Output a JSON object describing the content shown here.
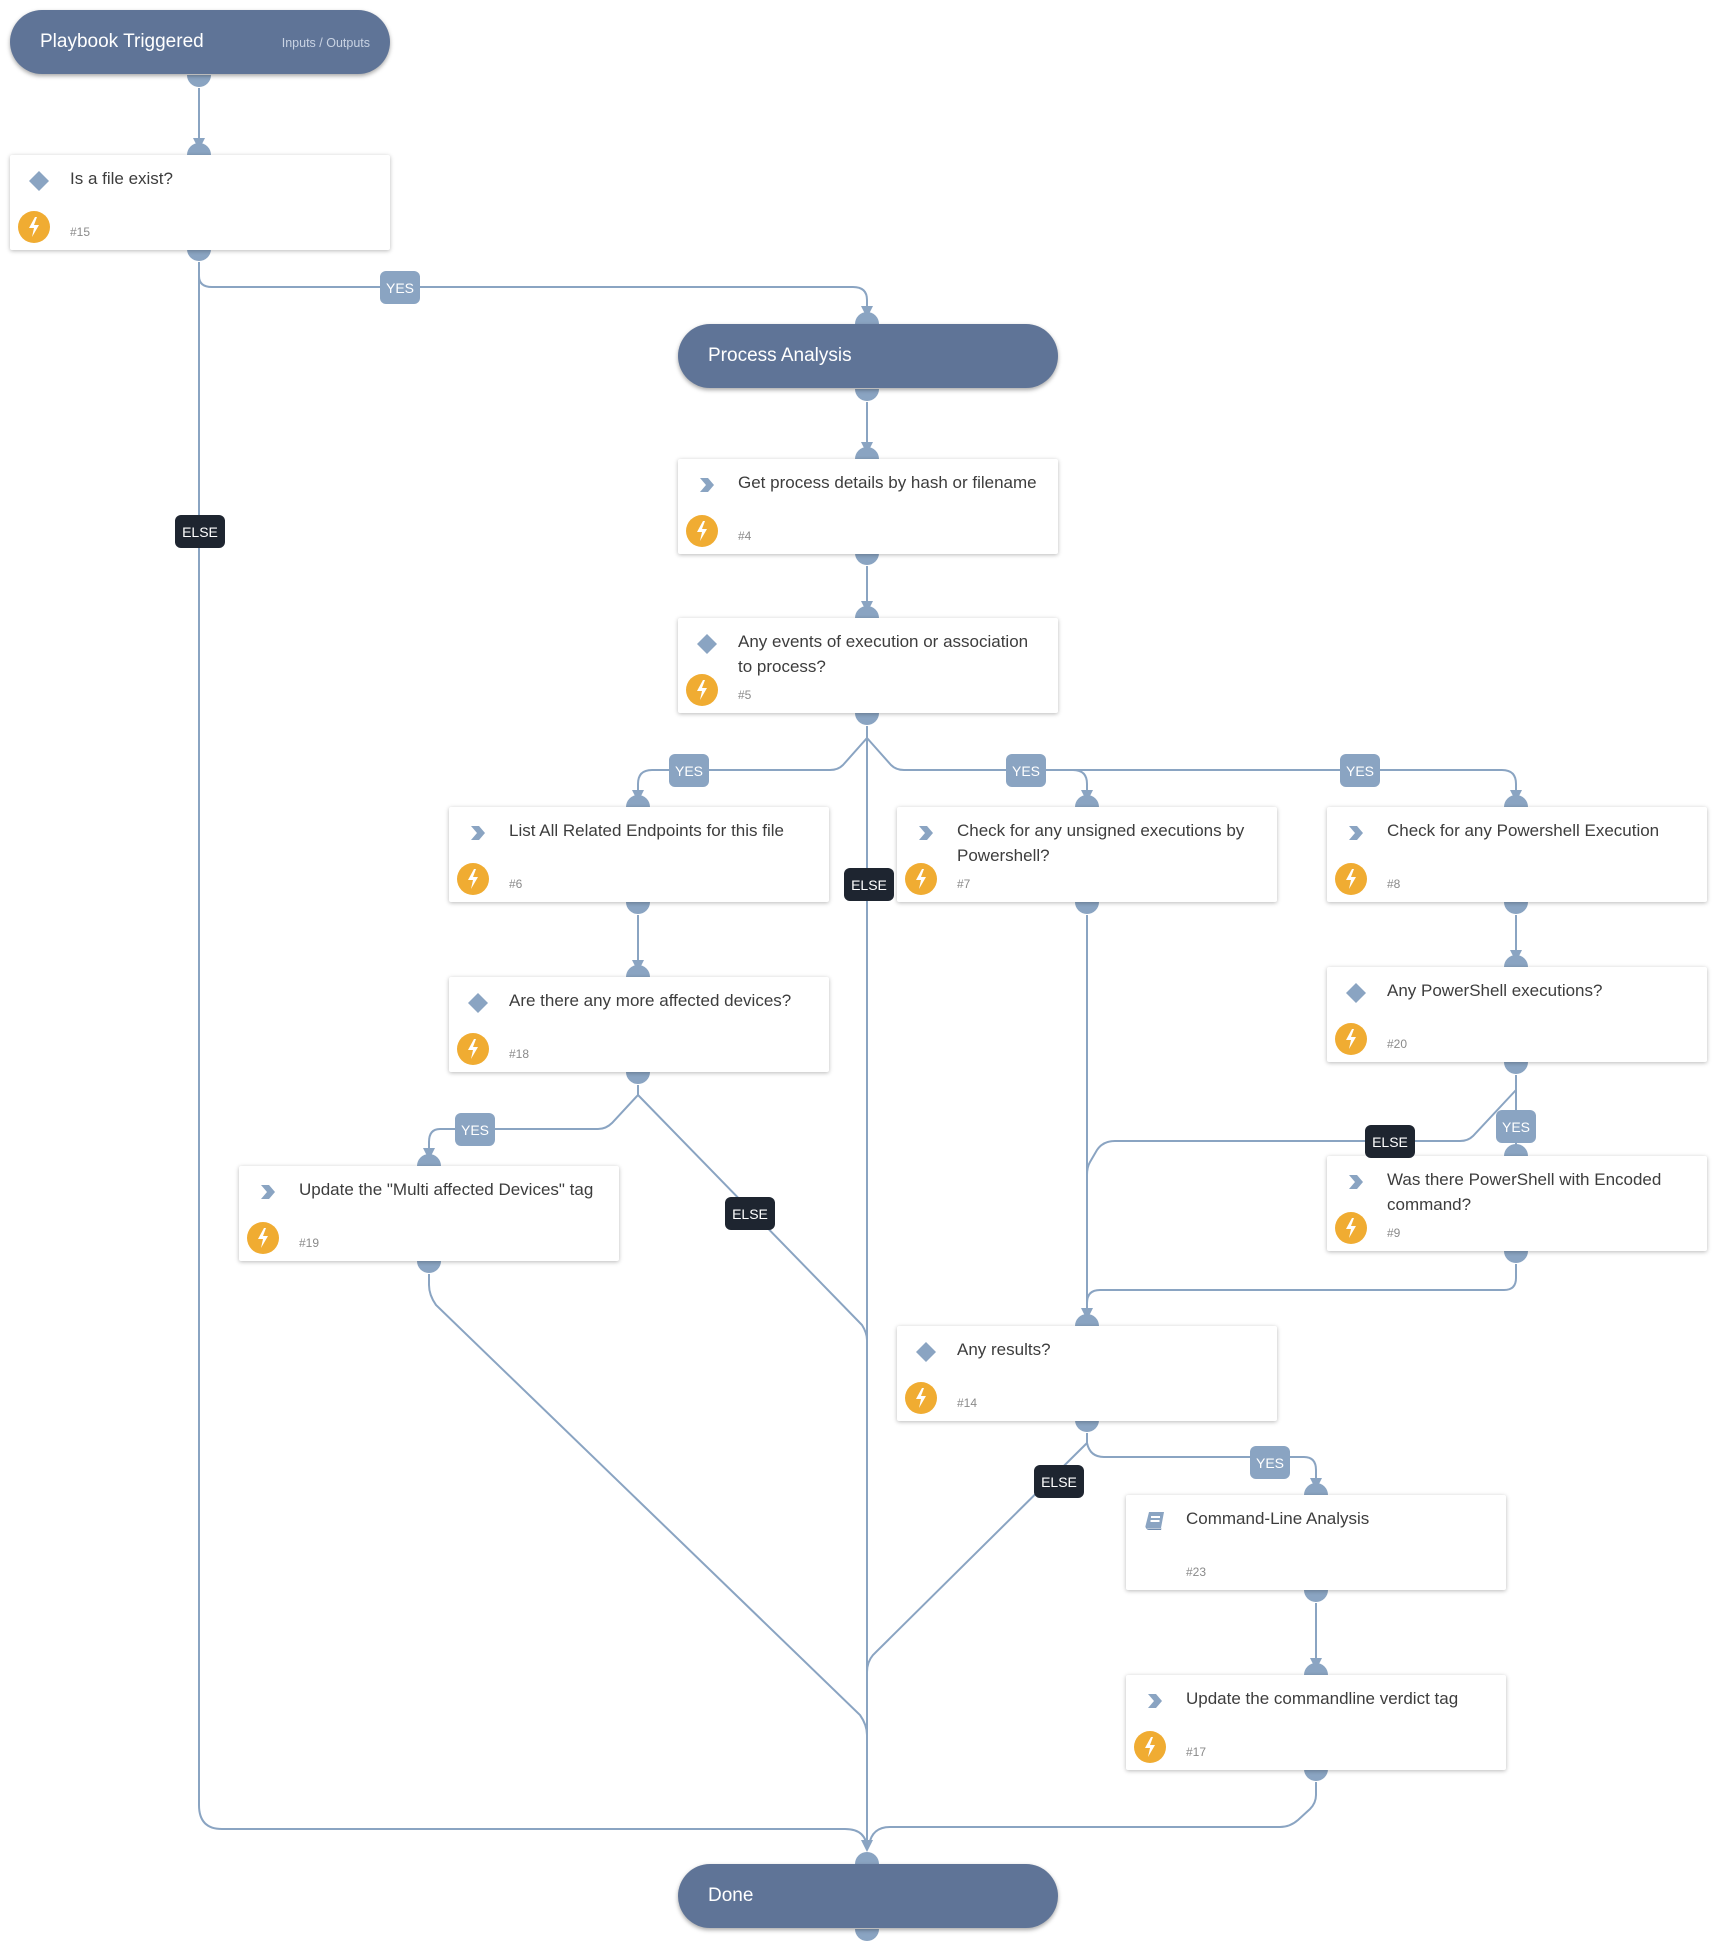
{
  "diagram": {
    "colors": {
      "pill": "#5f7497",
      "edge": "#8aa4c2",
      "automation_icon": "#f0ac32",
      "yes_badge": "#8aa4c2",
      "else_badge": "#1e2530"
    },
    "start": {
      "title": "Playbook Triggered",
      "io_link": "Inputs / Outputs"
    },
    "section": {
      "title": "Process Analysis"
    },
    "end": {
      "title": "Done"
    },
    "tasks": {
      "t15": {
        "label": "Is a file exist?",
        "num": "#15",
        "type": "condition"
      },
      "t4": {
        "label": "Get process details by hash or filename",
        "num": "#4",
        "type": "action"
      },
      "t5": {
        "label": "Any events of execution or association to process?",
        "num": "#5",
        "type": "condition"
      },
      "t6": {
        "label": "List All Related Endpoints for this file",
        "num": "#6",
        "type": "action"
      },
      "t7": {
        "label": "Check for any unsigned executions by Powershell?",
        "num": "#7",
        "type": "action"
      },
      "t8": {
        "label": "Check for any Powershell Execution",
        "num": "#8",
        "type": "action"
      },
      "t18": {
        "label": "Are there any more affected devices?",
        "num": "#18",
        "type": "condition"
      },
      "t20": {
        "label": "Any PowerShell executions?",
        "num": "#20",
        "type": "condition"
      },
      "t19": {
        "label": "Update the \"Multi affected Devices\" tag",
        "num": "#19",
        "type": "action"
      },
      "t9": {
        "label": "Was there PowerShell with Encoded command?",
        "num": "#9",
        "type": "action"
      },
      "t14": {
        "label": "Any results?",
        "num": "#14",
        "type": "condition"
      },
      "t23": {
        "label": "Command-Line Analysis",
        "num": "#23",
        "type": "playbook"
      },
      "t17": {
        "label": "Update the commandline verdict tag",
        "num": "#17",
        "type": "action"
      }
    },
    "branch_labels": {
      "yes": "YES",
      "else": "ELSE"
    }
  }
}
